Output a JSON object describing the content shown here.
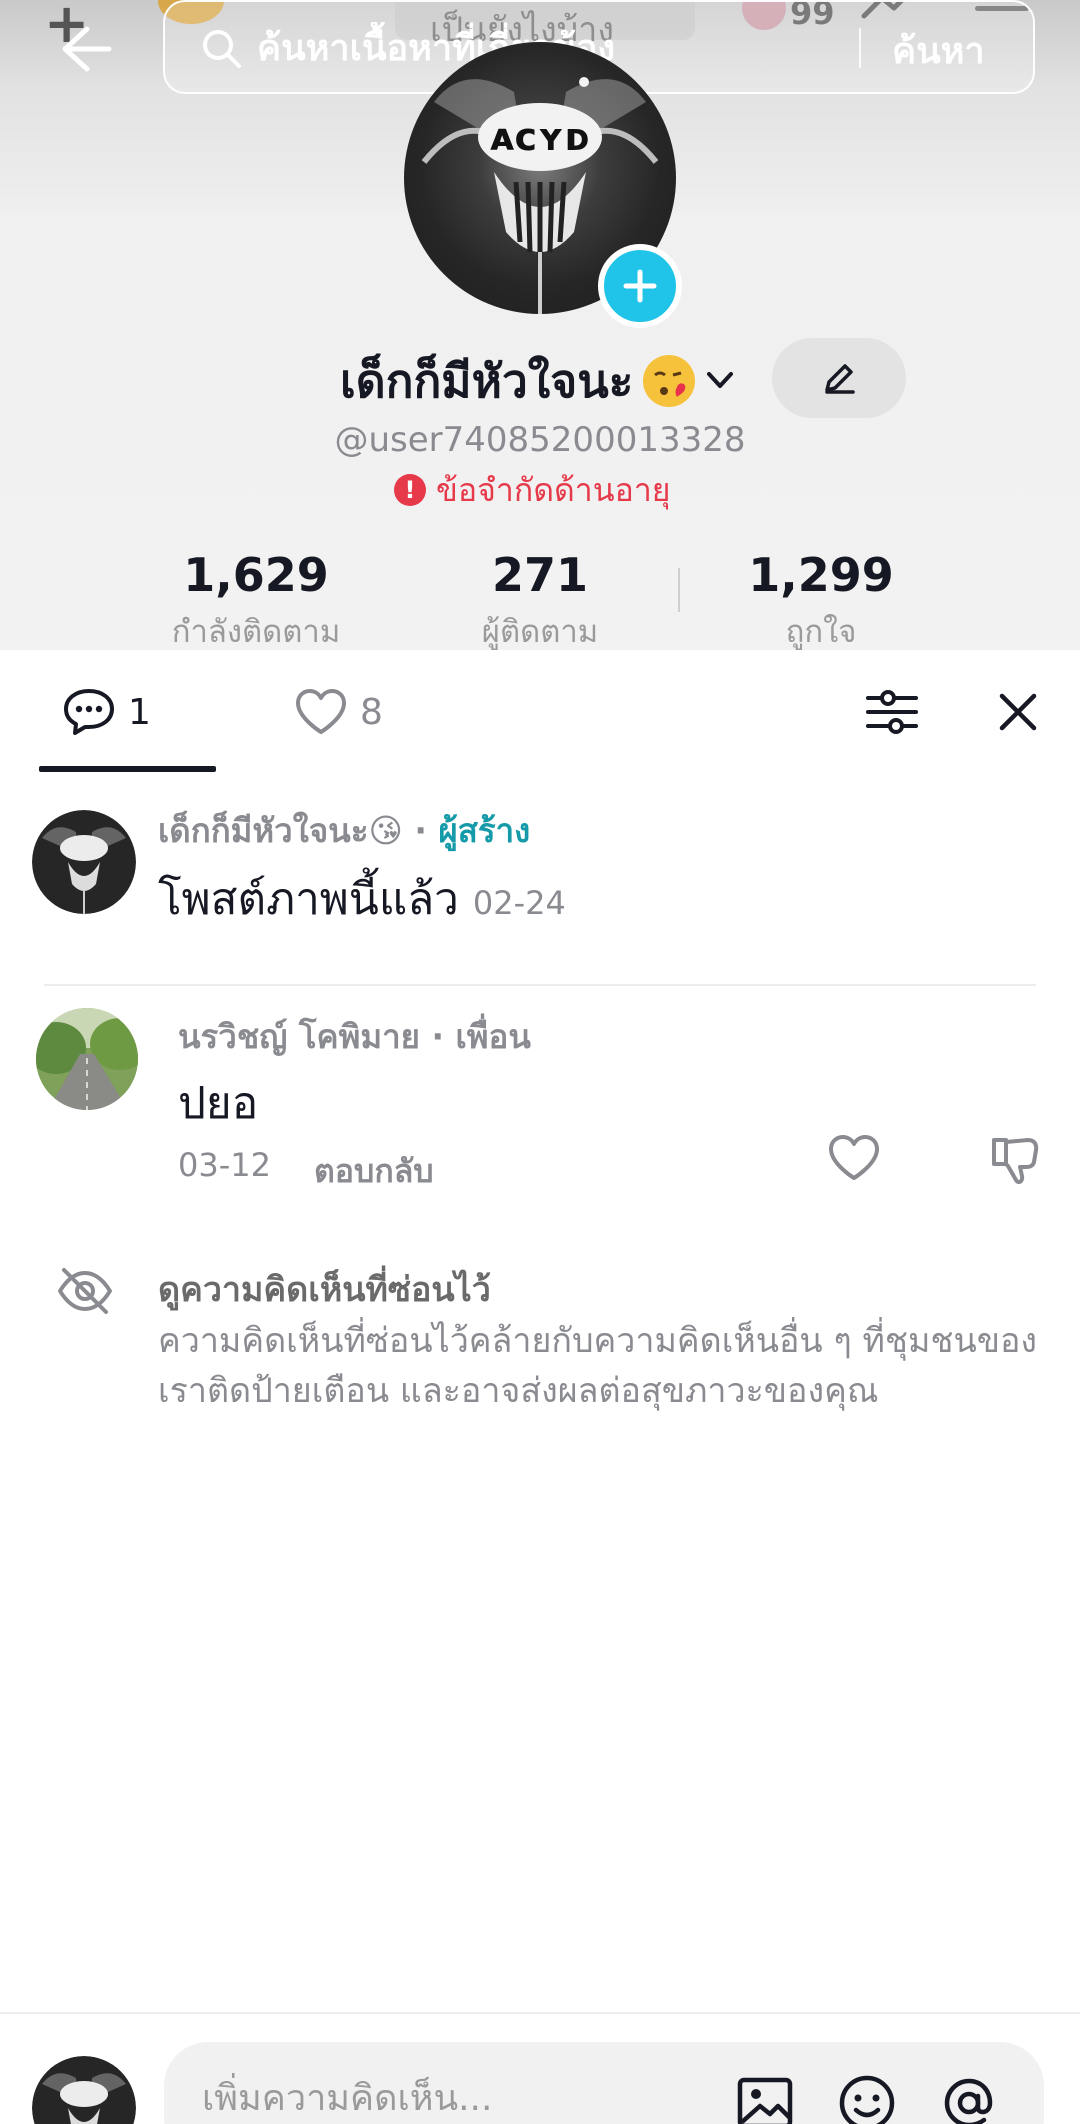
{
  "header": {
    "background_title": "เป็นยังไงบ้าง",
    "notification_count": "99",
    "search": {
      "placeholder": "ค้นหาเนื้อหาที่เกี่ยวข้อง",
      "submit_label": "ค้นหา"
    }
  },
  "profile": {
    "display_name": "เด็กก็มีหัวใจนะ",
    "name_emoji": "kissing-face-emoji",
    "username": "@user74085200013328",
    "age_restriction": "ข้อจำกัดด้านอายุ",
    "stats": [
      {
        "value": "1,629",
        "label": "กำลังติดตาม"
      },
      {
        "value": "271",
        "label": "ผู้ติดตาม"
      },
      {
        "value": "1,299",
        "label": "ถูกใจ"
      }
    ]
  },
  "sheet": {
    "tabs": {
      "comments_count": "1",
      "likes_count": "8"
    },
    "comments": [
      {
        "author": "เด็กก็มีหัวใจนะ",
        "separator": " · ",
        "role": "ผู้สร้าง",
        "text": "โพสต์ภาพนี้แล้ว",
        "time": "02-24"
      },
      {
        "author": "นรวิชญ์ โคพิมาย · เพื่อน",
        "text": "ปยอ",
        "time": "03-12",
        "reply_label": "ตอบกลับ"
      }
    ],
    "hidden": {
      "title": "ดูความคิดเห็นที่ซ่อนไว้",
      "description": "ความคิดเห็นที่ซ่อนไว้คล้ายกับความคิดเห็นอื่น ๆ ที่ชุมชนของเราติดป้ายเตือน และอาจส่งผลต่อสุขภาวะของคุณ"
    }
  },
  "composer": {
    "placeholder": "เพิ่มความคิดเห็น..."
  },
  "colors": {
    "accent_cyan": "#20c4e8",
    "creator_teal": "#149aa8",
    "warning_red": "#e6394a"
  }
}
